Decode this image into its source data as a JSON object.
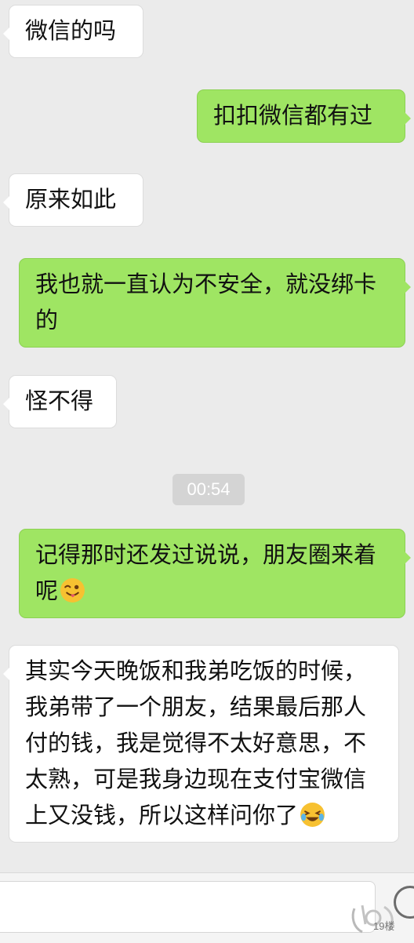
{
  "messages": [
    {
      "side": "in",
      "text": "微信的吗"
    },
    {
      "side": "out",
      "text": "扣扣微信都有过"
    },
    {
      "side": "in",
      "text": "原来如此"
    },
    {
      "side": "out",
      "text": "我也就一直认为不安全，就没绑卡的"
    },
    {
      "side": "in",
      "text": "怪不得"
    },
    {
      "side": "out",
      "text": "记得那时还发过说说，朋友圈来着呢",
      "emoji": "wink-tongue-emoji"
    },
    {
      "side": "in",
      "text": "其实今天晚饭和我弟吃饭的时候，我弟带了一个朋友，结果最后那人付的钱，我是觉得不太好意思，不太熟，可是我身边现在支付宝微信上又没钱，所以这样问你了",
      "emoji": "laugh-cry-emoji"
    }
  ],
  "timestamp": "00:54",
  "watermark": {
    "text": "19楼"
  },
  "colors": {
    "background": "#ebebeb",
    "incoming_bubble": "#ffffff",
    "outgoing_bubble": "#9fe563",
    "timestamp_bg": "#d4d4d4"
  },
  "icons": {
    "emoji_button": "smiley-face-icon"
  }
}
